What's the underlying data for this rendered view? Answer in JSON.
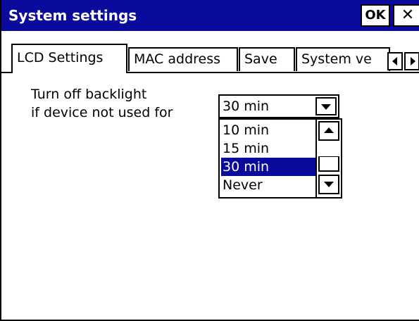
{
  "window": {
    "title": "System settings",
    "ok_label": "OK",
    "close_label": "✕"
  },
  "tabs": [
    {
      "label": "LCD Settings",
      "active": true
    },
    {
      "label": "MAC address",
      "active": false
    },
    {
      "label": "Save",
      "active": false
    },
    {
      "label": "System ve",
      "active": false
    }
  ],
  "lcd": {
    "label_line1": "Turn off backlight",
    "label_line2": "if  device not used for",
    "selected_value": "30 min",
    "options": [
      "10 min",
      "15 min",
      "30 min",
      "Never"
    ],
    "highlighted_option": "30 min"
  },
  "colors": {
    "title_bar": "#0a0a9c",
    "selection": "#0a0a9c",
    "background": "#ffffff"
  },
  "icons": {
    "tab_scroll_left": "triangle-left-icon",
    "tab_scroll_right": "triangle-right-icon",
    "combo_arrow": "triangle-down-icon",
    "list_up": "triangle-up-icon",
    "list_down": "triangle-down-icon"
  }
}
